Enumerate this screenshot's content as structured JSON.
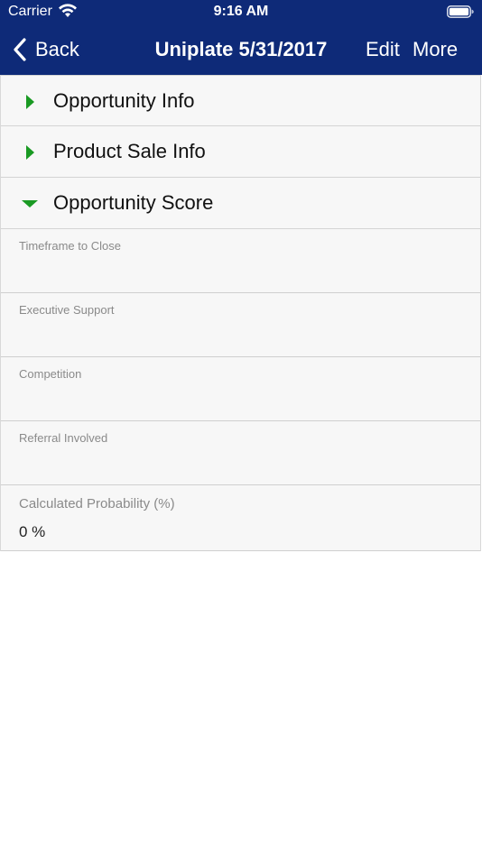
{
  "status_bar": {
    "carrier": "Carrier",
    "time": "9:16 AM"
  },
  "nav": {
    "back_label": "Back",
    "title": "Uniplate 5/31/2017",
    "edit_label": "Edit",
    "more_label": "More"
  },
  "colors": {
    "nav_background": "#0e2a78",
    "accent_green": "#1a9a23",
    "row_background": "#f7f7f7"
  },
  "sections": [
    {
      "label": "Opportunity Info",
      "expanded": false,
      "icon": "chevron-right-icon"
    },
    {
      "label": "Product Sale Info",
      "expanded": false,
      "icon": "chevron-right-icon"
    },
    {
      "label": "Opportunity Score",
      "expanded": true,
      "icon": "chevron-down-icon"
    }
  ],
  "score_fields": [
    {
      "label": "Timeframe to Close",
      "value": ""
    },
    {
      "label": "Executive Support",
      "value": ""
    },
    {
      "label": "Competition",
      "value": ""
    },
    {
      "label": "Referral Involved",
      "value": ""
    },
    {
      "label": "Calculated Probability (%)",
      "value": "0 %"
    }
  ]
}
